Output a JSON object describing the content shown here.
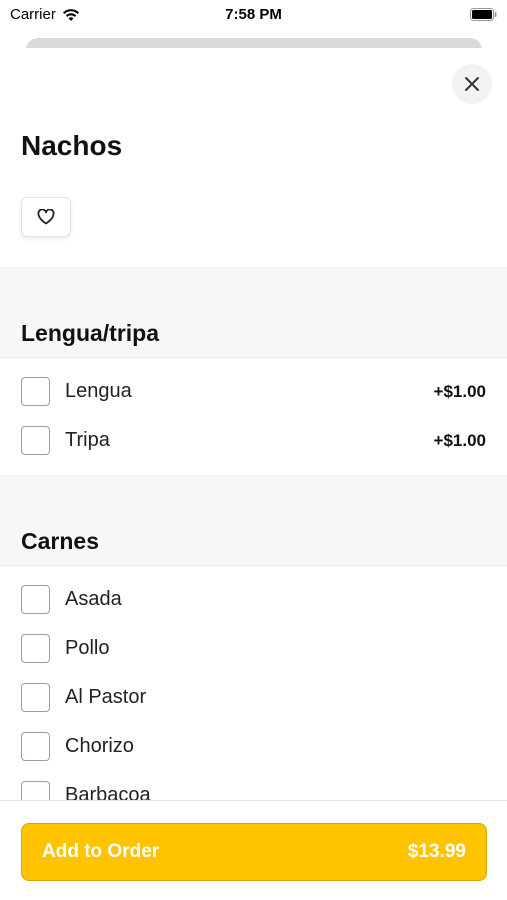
{
  "status_bar": {
    "carrier": "Carrier",
    "time": "7:58 PM"
  },
  "item": {
    "title": "Nachos"
  },
  "groups": [
    {
      "title": "Lengua/tripa",
      "options": [
        {
          "label": "Lengua",
          "price": "+$1.00"
        },
        {
          "label": "Tripa",
          "price": "+$1.00"
        }
      ]
    },
    {
      "title": "Carnes",
      "options": [
        {
          "label": "Asada",
          "price": ""
        },
        {
          "label": "Pollo",
          "price": ""
        },
        {
          "label": "Al Pastor",
          "price": ""
        },
        {
          "label": "Chorizo",
          "price": ""
        },
        {
          "label": "Barbacoa",
          "price": ""
        }
      ]
    }
  ],
  "footer": {
    "button_label": "Add to Order",
    "total": "$13.99"
  },
  "colors": {
    "accent": "#ffc300",
    "accent_border": "#d9a500",
    "section_bg": "#f7f7f7"
  },
  "icons": [
    "wifi-icon",
    "battery-icon",
    "close-icon",
    "heart-icon"
  ]
}
